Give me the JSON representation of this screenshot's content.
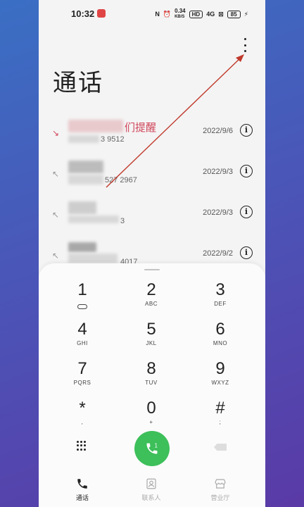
{
  "status_bar": {
    "time": "10:32",
    "nfc": "N",
    "alarm": "⏰",
    "speed": "0.34",
    "speed_unit": "KB/S",
    "hd": "HD",
    "signal": "4G",
    "wifi": "⊠",
    "battery": "85",
    "charging": "⚡"
  },
  "header": {
    "title": "通话"
  },
  "calls": [
    {
      "direction": "missed",
      "name": "们提醒",
      "number": "3 9512",
      "date": "2022/9/6"
    },
    {
      "direction": "outgoing",
      "name": "",
      "number": "527 2967",
      "date": "2022/9/3"
    },
    {
      "direction": "outgoing",
      "name": "",
      "number": "3",
      "date": "2022/9/3"
    },
    {
      "direction": "outgoing",
      "name": "",
      "number": "4017",
      "date": "2022/9/2"
    }
  ],
  "dialpad": {
    "keys": [
      {
        "digit": "1",
        "letters": ""
      },
      {
        "digit": "2",
        "letters": "ABC"
      },
      {
        "digit": "3",
        "letters": "DEF"
      },
      {
        "digit": "4",
        "letters": "GHI"
      },
      {
        "digit": "5",
        "letters": "JKL"
      },
      {
        "digit": "6",
        "letters": "MNO"
      },
      {
        "digit": "7",
        "letters": "PQRS"
      },
      {
        "digit": "8",
        "letters": "TUV"
      },
      {
        "digit": "9",
        "letters": "WXYZ"
      },
      {
        "digit": "*",
        "letters": ","
      },
      {
        "digit": "0",
        "letters": "+"
      },
      {
        "digit": "#",
        "letters": ";"
      }
    ]
  },
  "tabs": [
    {
      "label": "通话",
      "icon": "phone-icon",
      "active": true
    },
    {
      "label": "联系人",
      "icon": "contacts-icon",
      "active": false
    },
    {
      "label": "营业厅",
      "icon": "store-icon",
      "active": false
    }
  ],
  "colors": {
    "missed": "#d0455a",
    "call_button": "#3dbf5a",
    "annotation_arrow": "#c0392b"
  }
}
